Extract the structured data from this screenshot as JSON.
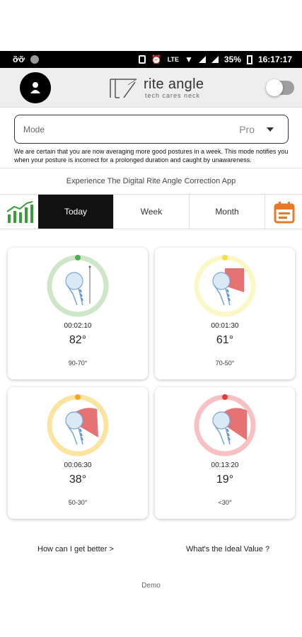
{
  "status_bar": {
    "carrier": "ỡỡ",
    "network": "LTE",
    "battery": "35%",
    "time": "16:17:17"
  },
  "header": {
    "brand": "rite angle",
    "tagline": "tech cares neck",
    "toggle_on": false
  },
  "mode": {
    "label": "Mode",
    "value": "Pro",
    "description": "We are certain that you are now averaging more good postures in a week. This mode notifies you when your posture is incorrect for a prolonged duration and caught by unawareness."
  },
  "experience_text": "Experience The Digital Rite Angle Correction App",
  "tabs": {
    "items": [
      "Today",
      "Week",
      "Month"
    ],
    "active": "Today",
    "left_icon": "chart-icon",
    "right_icon": "calendar-icon"
  },
  "cards": [
    {
      "time": "00:02:10",
      "angle": "82°",
      "range": "90-70°",
      "ring_color": "#cde6c8",
      "dot_color": "#4caf50",
      "wedge": "none"
    },
    {
      "time": "00:01:30",
      "angle": "61°",
      "range": "70-50°",
      "ring_color": "#fbf7c6",
      "dot_color": "#f4e13b",
      "wedge": "small"
    },
    {
      "time": "00:06:30",
      "angle": "38°",
      "range": "50-30°",
      "ring_color": "#fbe3a0",
      "dot_color": "#f5a623",
      "wedge": "medium"
    },
    {
      "time": "00:13:20",
      "angle": "19°",
      "range": "<30°",
      "ring_color": "#f7c1c4",
      "dot_color": "#e53935",
      "wedge": "large"
    }
  ],
  "links": {
    "improve": "How can I get better >",
    "ideal": "What's the Ideal Value ?"
  },
  "footer": {
    "demo": "Demo"
  },
  "colors": {
    "accent_orange": "#e57a2a",
    "chart_green": "#3a9b3a",
    "wedge_red": "#e57373"
  }
}
